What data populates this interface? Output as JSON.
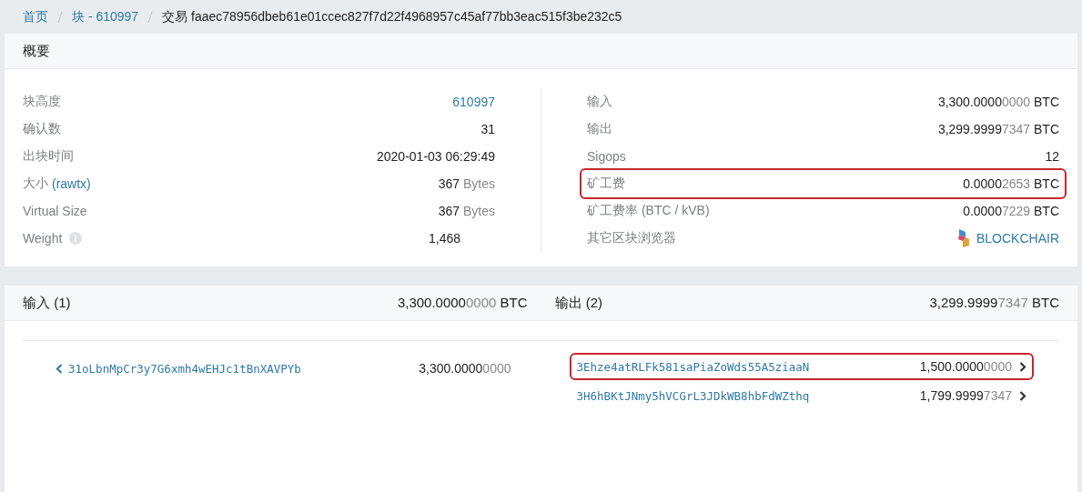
{
  "breadcrumb": [
    {
      "label": "首页",
      "link": true
    },
    {
      "label": "块 - 610997",
      "link": true
    },
    {
      "label": "交易 faaec78956dbeb61e01ccec827f7d22f4968957c45af77bb3eac515f3be232c5",
      "link": false
    }
  ],
  "summary": {
    "title": "概要",
    "left_rows": [
      {
        "kind": "link",
        "label": "块高度",
        "value": "610997"
      },
      {
        "kind": "plain",
        "label": "确认数",
        "value": "31"
      },
      {
        "kind": "plain",
        "label": "出块时间",
        "value": "2020-01-03 06:29:49"
      },
      {
        "kind": "size",
        "label": "大小",
        "label_link": "(rawtx)",
        "value": "367",
        "unit": "Bytes"
      },
      {
        "kind": "size",
        "label": "Virtual Size",
        "value": "367",
        "unit": "Bytes"
      },
      {
        "kind": "info",
        "label": "Weight",
        "value": "1,468"
      }
    ],
    "right_rows": [
      {
        "kind": "amount",
        "label": "输入",
        "amount": "3,300.0000",
        "amount_dim": "0000",
        "unit": "BTC",
        "highlighted": false
      },
      {
        "kind": "amount",
        "label": "输出",
        "amount": "3,299.9999",
        "amount_dim": "7347",
        "unit": "BTC",
        "highlighted": false
      },
      {
        "kind": "plain",
        "label": "Sigops",
        "value": "12",
        "highlighted": false
      },
      {
        "kind": "amount",
        "label": "矿工费",
        "amount": "0.0000",
        "amount_dim": "2653",
        "unit": "BTC",
        "highlighted": true
      },
      {
        "kind": "amount",
        "label": "矿工费率 (BTC / kVB)",
        "amount": "0.0000",
        "amount_dim": "7229",
        "unit": "BTC",
        "highlighted": false
      },
      {
        "kind": "explorer",
        "label": "其它区块浏览器",
        "value": "BLOCKCHAIR",
        "highlighted": false
      }
    ]
  },
  "io": {
    "inputs_title": "输入 (1)",
    "inputs_total": {
      "amount": "3,300.0000",
      "amount_dim": "0000",
      "unit": "BTC"
    },
    "outputs_title": "输出 (2)",
    "outputs_total": {
      "amount": "3,299.9999",
      "amount_dim": "7347",
      "unit": "BTC"
    },
    "inputs": [
      {
        "address": "31oLbnMpCr3y7G6xmh4wEHJc1tBnXAVPYb",
        "amount": "3,300.0000",
        "amount_dim": "0000"
      }
    ],
    "outputs": [
      {
        "address": "3Ehze4atRLFk581saPiaZoWds55A5ziaaN",
        "amount": "1,500.0000",
        "amount_dim": "0000",
        "highlighted": true
      },
      {
        "address": "3H6hBKtJNmy5hVCGrL3JDkWB8hbFdWZthq",
        "amount": "1,799.9999",
        "amount_dim": "7347",
        "highlighted": false
      }
    ]
  }
}
